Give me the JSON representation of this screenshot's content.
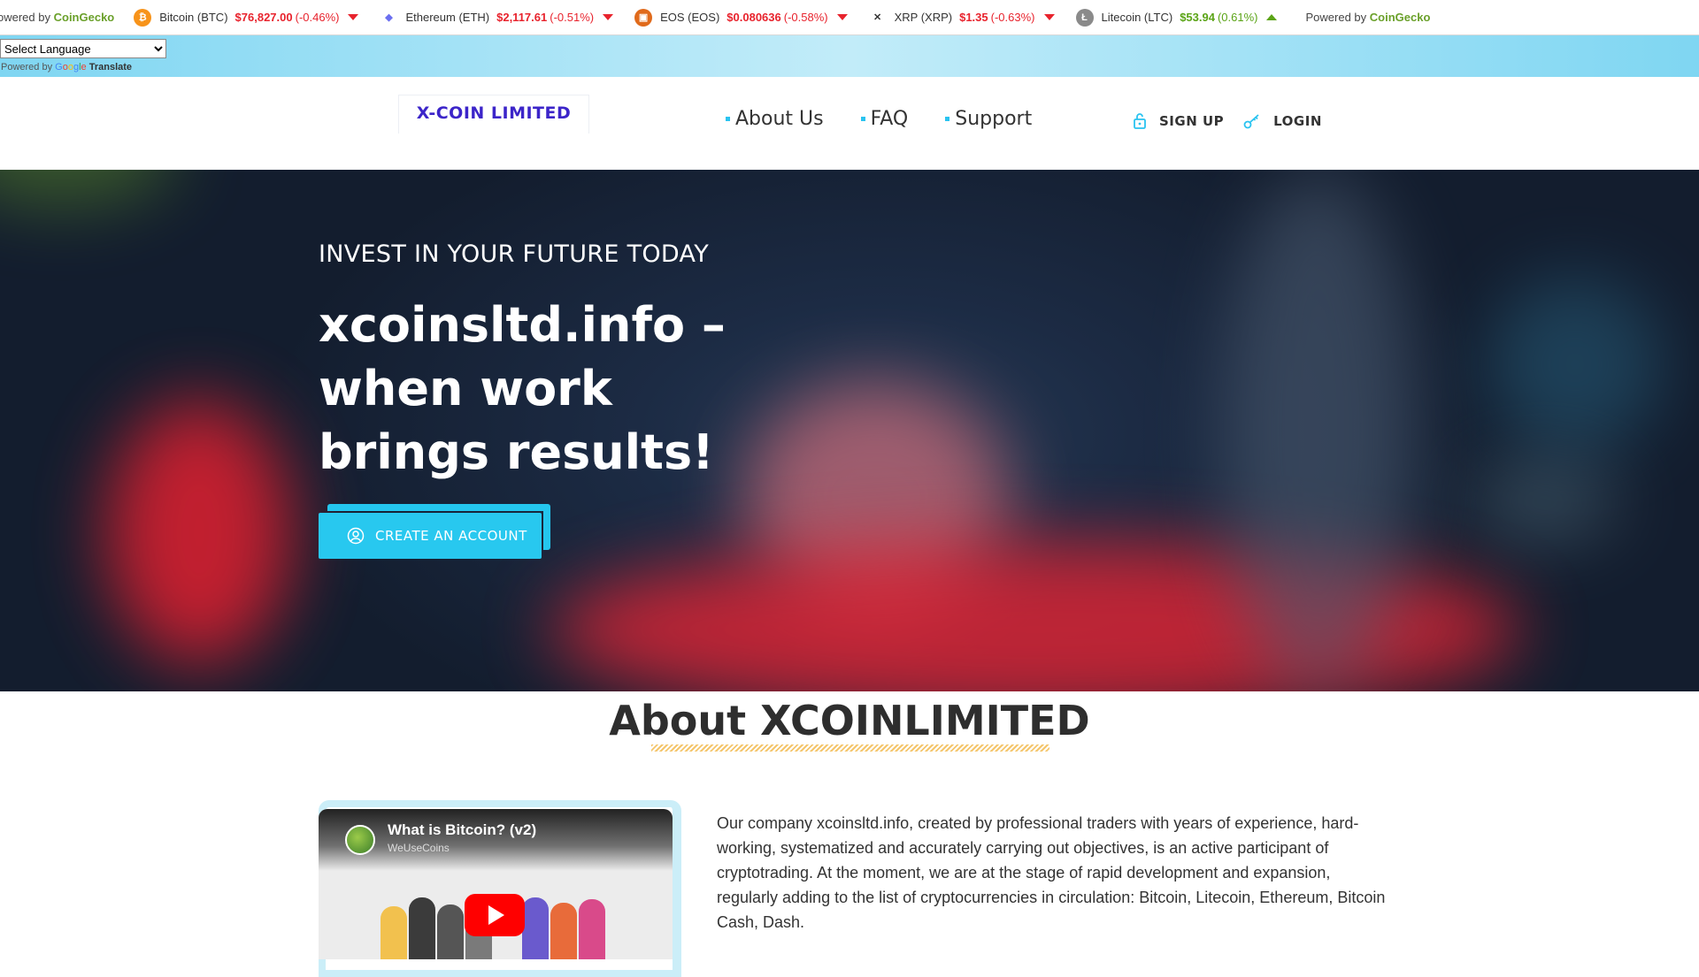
{
  "ticker": {
    "powered_prefix": "owered by",
    "powered_prefix_full": "Powered by",
    "powered_brand": "CoinGecko",
    "coins": [
      {
        "name": "Bitcoin (BTC)",
        "price": "$76,827.00",
        "change": "(-0.46%)",
        "direction": "down",
        "icon": "bitcoin-icon",
        "color": "#f7931a",
        "glyph": "₿"
      },
      {
        "name": "Ethereum (ETH)",
        "price": "$2,117.61",
        "change": "(-0.51%)",
        "direction": "down",
        "icon": "ethereum-icon",
        "color": "#6b6ff0",
        "glyph": "◆"
      },
      {
        "name": "EOS (EOS)",
        "price": "$0.080636",
        "change": "(-0.58%)",
        "direction": "down",
        "icon": "eos-icon",
        "color": "#e06a1b",
        "glyph": "▣"
      },
      {
        "name": "XRP (XRP)",
        "price": "$1.35",
        "change": "(-0.63%)",
        "direction": "down",
        "icon": "xrp-icon",
        "color": "#333333",
        "glyph": "✕"
      },
      {
        "name": "Litecoin (LTC)",
        "price": "$53.94",
        "change": "(0.61%)",
        "direction": "up",
        "icon": "litecoin-icon",
        "color": "#8a8a8a",
        "glyph": "Ł"
      }
    ]
  },
  "translate": {
    "select_label": "Select Language",
    "powered_by": "Powered by",
    "google": [
      "G",
      "o",
      "o",
      "g",
      "l",
      "e"
    ],
    "translate_word": "Translate"
  },
  "header": {
    "logo": "X-COIN LIMITED",
    "nav": [
      "About Us",
      "FAQ",
      "Support"
    ],
    "signup": "SIGN UP",
    "login": "LOGIN",
    "accent_color": "#29c3f0"
  },
  "hero": {
    "tagline": "INVEST IN YOUR FUTURE TODAY",
    "title": "xcoinsltd.info – when work brings results!",
    "cta": "CREATE AN ACCOUNT"
  },
  "about": {
    "title": "About XCOINLIMITED",
    "video_title": "What is Bitcoin? (v2)",
    "video_channel": "WeUseCoins",
    "text": "Our company xcoinsltd.info, created by professional traders with years of experience, hard-working, systematized and accurately carrying out objectives, is an active participant of cryptotrading. At the moment, we are at the stage of rapid development and expansion, regularly adding to the list of cryptocurrencies in circulation: Bitcoin, Litecoin, Ethereum, Bitcoin Cash, Dash."
  }
}
